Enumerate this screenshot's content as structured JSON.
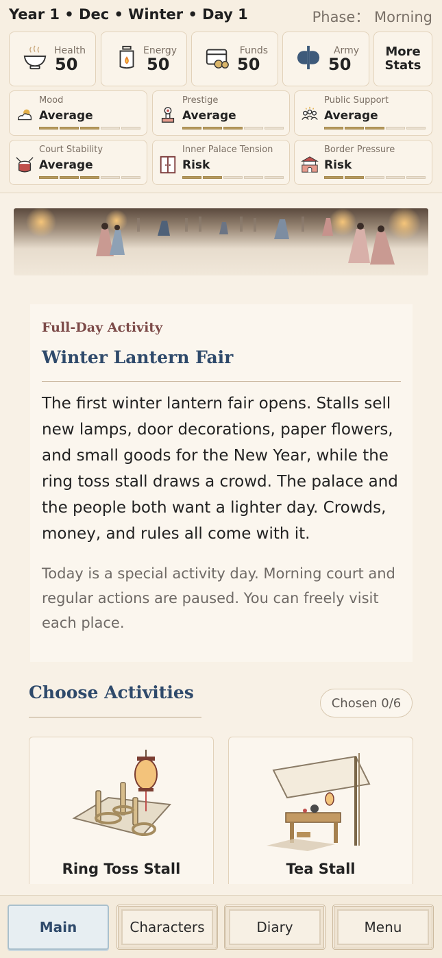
{
  "header": {
    "date": "Year 1 • Dec • Winter • Day 1",
    "phase": "Phase： Morning"
  },
  "main_stats": [
    {
      "label": "Health",
      "value": "50",
      "icon": "bowl-icon"
    },
    {
      "label": "Energy",
      "value": "50",
      "icon": "lantern-icon"
    },
    {
      "label": "Funds",
      "value": "50",
      "icon": "coin-chest-icon"
    },
    {
      "label": "Army",
      "value": "50",
      "icon": "axe-icon"
    }
  ],
  "more_stats_label": "More Stats",
  "sub_stats": [
    {
      "label": "Mood",
      "value": "Average",
      "level": 3,
      "max": 5,
      "icon": "sun-cloud-icon"
    },
    {
      "label": "Prestige",
      "value": "Average",
      "level": 3,
      "max": 5,
      "icon": "seal-icon"
    },
    {
      "label": "Public Support",
      "value": "Average",
      "level": 3,
      "max": 5,
      "icon": "people-icon"
    },
    {
      "label": "Court Stability",
      "value": "Average",
      "level": 3,
      "max": 5,
      "icon": "drum-icon"
    },
    {
      "label": "Inner Palace Tension",
      "value": "Risk",
      "level": 2,
      "max": 5,
      "icon": "door-icon"
    },
    {
      "label": "Border Pressure",
      "value": "Risk",
      "level": 2,
      "max": 5,
      "icon": "gate-tower-icon"
    }
  ],
  "event": {
    "kicker": "Full-Day Activity",
    "title": "Winter Lantern Fair",
    "description": "The first winter lantern fair opens. Stalls sell new lamps, door decorations, paper flowers, and small goods for the New Year, while the ring toss stall draws a crowd. The palace and the people both want a lighter day. Crowds, money, and rules all come with it.",
    "note": "Today is a special activity day. Morning court and regular actions are paused. You can freely visit each place."
  },
  "activities_section": {
    "title": "Choose Activities",
    "chosen": "Chosen 0/6",
    "items": [
      {
        "name": "Ring Toss Stall",
        "art": "ring-toss-art"
      },
      {
        "name": "Tea Stall",
        "art": "tea-stall-art"
      }
    ]
  },
  "nav": {
    "main": "Main",
    "characters": "Characters",
    "diary": "Diary",
    "menu": "Menu"
  },
  "colors": {
    "accent_blue": "#2f4a6b",
    "accent_red": "#7c4a48",
    "bar_on": "#b69a5e",
    "background": "#f8f1e6"
  }
}
